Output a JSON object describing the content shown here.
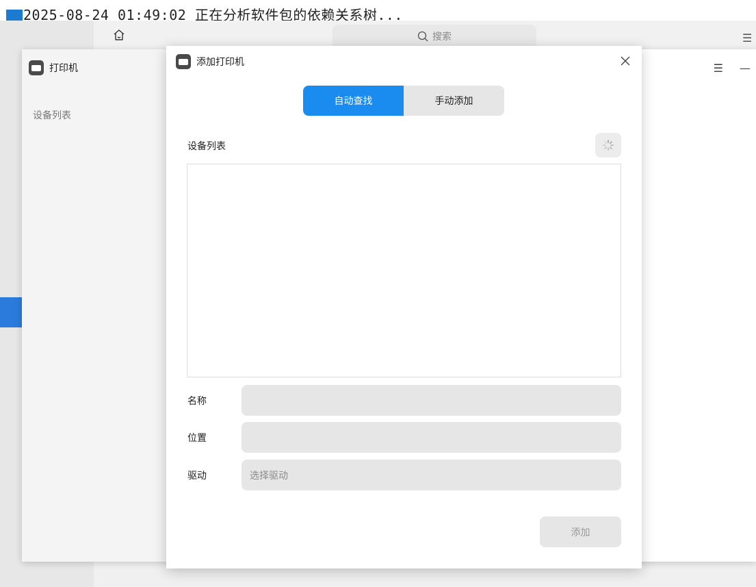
{
  "terminal": {
    "text": "2025-08-24 01:49:02 正在分析软件包的依赖关系树..."
  },
  "background_app": {
    "search_placeholder": "搜索"
  },
  "printer_manager": {
    "title": "打印机",
    "section_label": "设备列表"
  },
  "dialog": {
    "title": "添加打印机",
    "tabs": [
      {
        "label": "自动查找",
        "active": true
      },
      {
        "label": "手动添加",
        "active": false
      }
    ],
    "device_list_label": "设备列表",
    "fields": {
      "name_label": "名称",
      "name_value": "",
      "location_label": "位置",
      "location_value": "",
      "driver_label": "驱动",
      "driver_placeholder": "选择驱动"
    },
    "add_button": "添加"
  },
  "colors": {
    "accent": "#1a8cf0",
    "field_bg": "#e6e6e6"
  },
  "icons": [
    "home-icon",
    "search-icon",
    "menu-icon",
    "printer-icon",
    "close-icon",
    "refresh-spinner-icon",
    "minimize-icon"
  ]
}
